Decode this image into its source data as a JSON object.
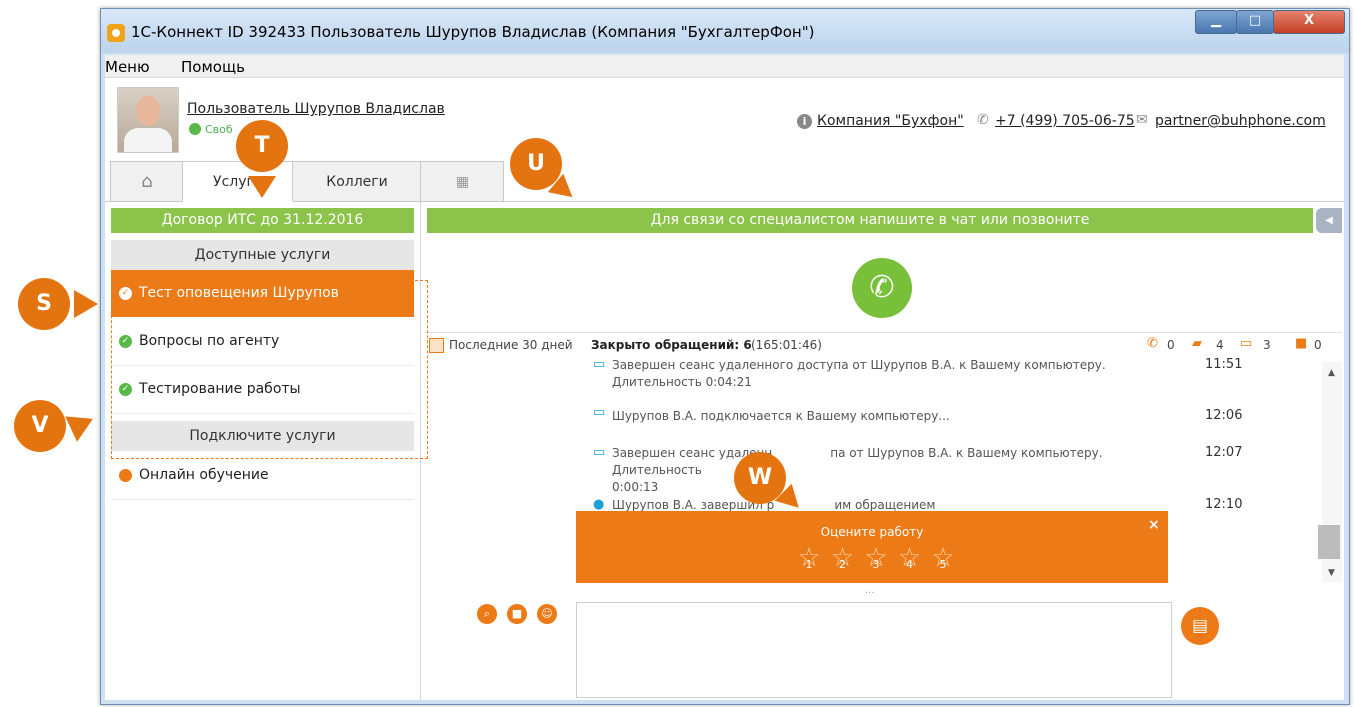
{
  "window": {
    "title": "1С-Коннект ID 392433 Пользователь Шурупов Владислав  (Компания \"БухгалтерФон\")",
    "min_label": "▁",
    "max_label": "□",
    "close_label": "X"
  },
  "menu": {
    "items": [
      "Меню",
      "Помощь"
    ]
  },
  "header": {
    "user_name": "Пользователь Шурупов Владислав",
    "status": "Своб",
    "company_link": "Компания \"Бухфон\"",
    "phone": "+7 (499) 705-06-75",
    "email": "partner@buhphone.com"
  },
  "tabs": {
    "home_icon": "home-icon",
    "services": "Услуги",
    "colleagues": "Коллеги",
    "apps_icon": "grid-icon"
  },
  "left_panel": {
    "contract": "Договор ИТС до 31.12.2016",
    "available_header": "Доступные услуги",
    "available": [
      "Тест оповещения Шурупов",
      "Вопросы по агенту",
      "Тестирование работы"
    ],
    "connect_header": "Подключите услуги",
    "connect": [
      "Онлайн обучение"
    ]
  },
  "right_panel": {
    "banner": "Для связи со специалистом напишите в чат или позвоните",
    "stats": {
      "period": "Последние 30 дней",
      "closed_label": "Закрыто обращений: 6",
      "duration": "(165:01:46)",
      "calls": "0",
      "chats": "4",
      "remote": "3",
      "saved": "0"
    },
    "log": [
      {
        "icon": "monitor-icon",
        "text": "Завершен сеанс удаленного доступа от Шурупов В.А. к Вашему компьютеру. Длительность 0:04:21",
        "time": "11:51"
      },
      {
        "icon": "remote-access-icon",
        "text": "Шурупов В.А. подключается к Вашему компьютеру...",
        "time": "12:06"
      },
      {
        "icon": "remote-access-icon",
        "text_a": "Завершен сеанс удаленн",
        "text_b": "па от Шурупов В.А. к Вашему компьютеру. Длительность",
        "text_c": "0:00:13",
        "time": "12:07"
      },
      {
        "icon": "user-icon",
        "text_a": "Шурупов В.А. завершил р",
        "text_b": "им обращением",
        "time": "12:10"
      }
    ],
    "rating": {
      "title": "Оцените работу",
      "close": "×",
      "stars": [
        "1",
        "2",
        "3",
        "4",
        "5"
      ]
    },
    "resize_handle": "...",
    "send_icon": "chat-send-icon"
  },
  "badges": {
    "s": "S",
    "t": "T",
    "u": "U",
    "v": "V",
    "w": "W"
  },
  "colors": {
    "accent": "#ec7a16",
    "green": "#8cc34b",
    "call_green": "#78bf3a"
  }
}
